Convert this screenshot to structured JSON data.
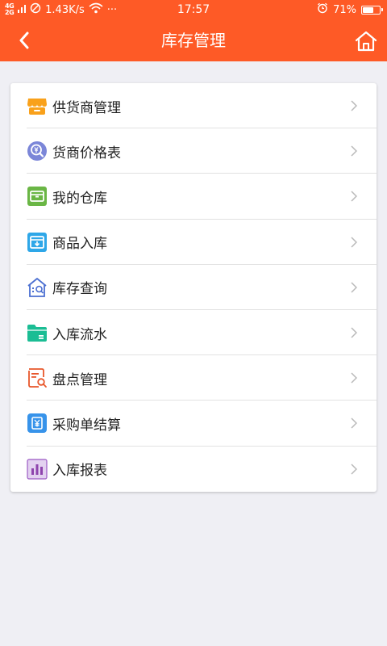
{
  "status_bar": {
    "network_line1": "4G",
    "network_line2": "2G",
    "speed": "1.43K/s",
    "more": "···",
    "time": "17:57",
    "battery_text": "71%",
    "battery_level": 0.71
  },
  "header": {
    "title": "库存管理"
  },
  "menu": {
    "items": [
      {
        "label": "供货商管理",
        "icon": "shop-icon"
      },
      {
        "label": "货商价格表",
        "icon": "price-search-icon"
      },
      {
        "label": "我的仓库",
        "icon": "warehouse-box-icon"
      },
      {
        "label": "商品入库",
        "icon": "inbound-tray-icon"
      },
      {
        "label": "库存查询",
        "icon": "stock-search-house-icon"
      },
      {
        "label": "入库流水",
        "icon": "folder-log-icon"
      },
      {
        "label": "盘点管理",
        "icon": "inventory-check-icon"
      },
      {
        "label": "采购单结算",
        "icon": "yuan-payment-icon"
      },
      {
        "label": "入库报表",
        "icon": "bar-chart-icon"
      }
    ]
  },
  "colors": {
    "accent": "#fe5a26",
    "background": "#efeff4"
  }
}
